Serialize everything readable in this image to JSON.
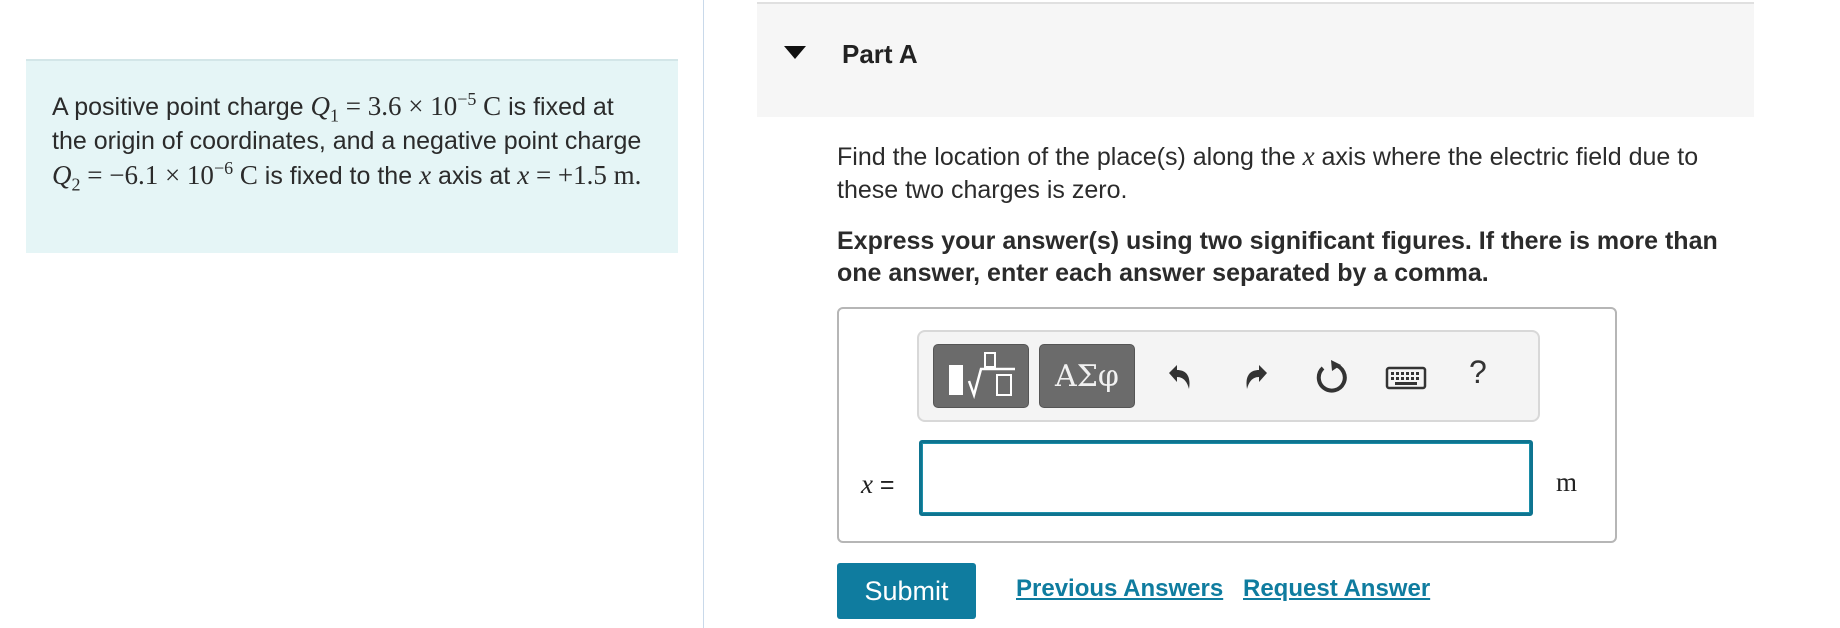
{
  "problem": {
    "text_1": "A positive point charge ",
    "q1_symbol": "Q",
    "q1_sub": "1",
    "q1_value": " = 3.6 × 10",
    "q1_exp": "−5",
    "q1_unit": " C",
    "text_2": " is fixed at the origin of coordinates, and a negative point charge ",
    "q2_symbol": "Q",
    "q2_sub": "2",
    "q2_value": " = −6.1 × 10",
    "q2_exp": "−6",
    "q2_unit": " C",
    "text_3": " is fixed to the ",
    "axis_var": "x",
    "text_4": " axis at ",
    "pos_var": "x",
    "pos_value": " = +1.5 m",
    "text_5": "."
  },
  "part": {
    "title": "Part A"
  },
  "question": {
    "text_1": "Find the location of the place(s) along the ",
    "var": "x",
    "text_2": " axis where the electric field due to these two charges is zero."
  },
  "instruction": "Express your answer(s) using two significant figures. If there is more than one answer, enter each answer separated by a comma.",
  "toolbar": {
    "greek_label": "ΑΣφ",
    "help_label": "?",
    "icons": [
      "templates-icon",
      "undo-icon",
      "redo-icon",
      "reset-icon",
      "keyboard-icon",
      "help-icon"
    ]
  },
  "answer": {
    "var_label": "x",
    "equals": " =",
    "value": "",
    "unit": "m"
  },
  "actions": {
    "submit_label": "Submit",
    "previous_label": "Previous Answers",
    "request_label": "Request Answer"
  },
  "colors": {
    "problem_bg": "#e5f5f6",
    "accent": "#0f7c9f",
    "input_border": "#0e7490"
  }
}
